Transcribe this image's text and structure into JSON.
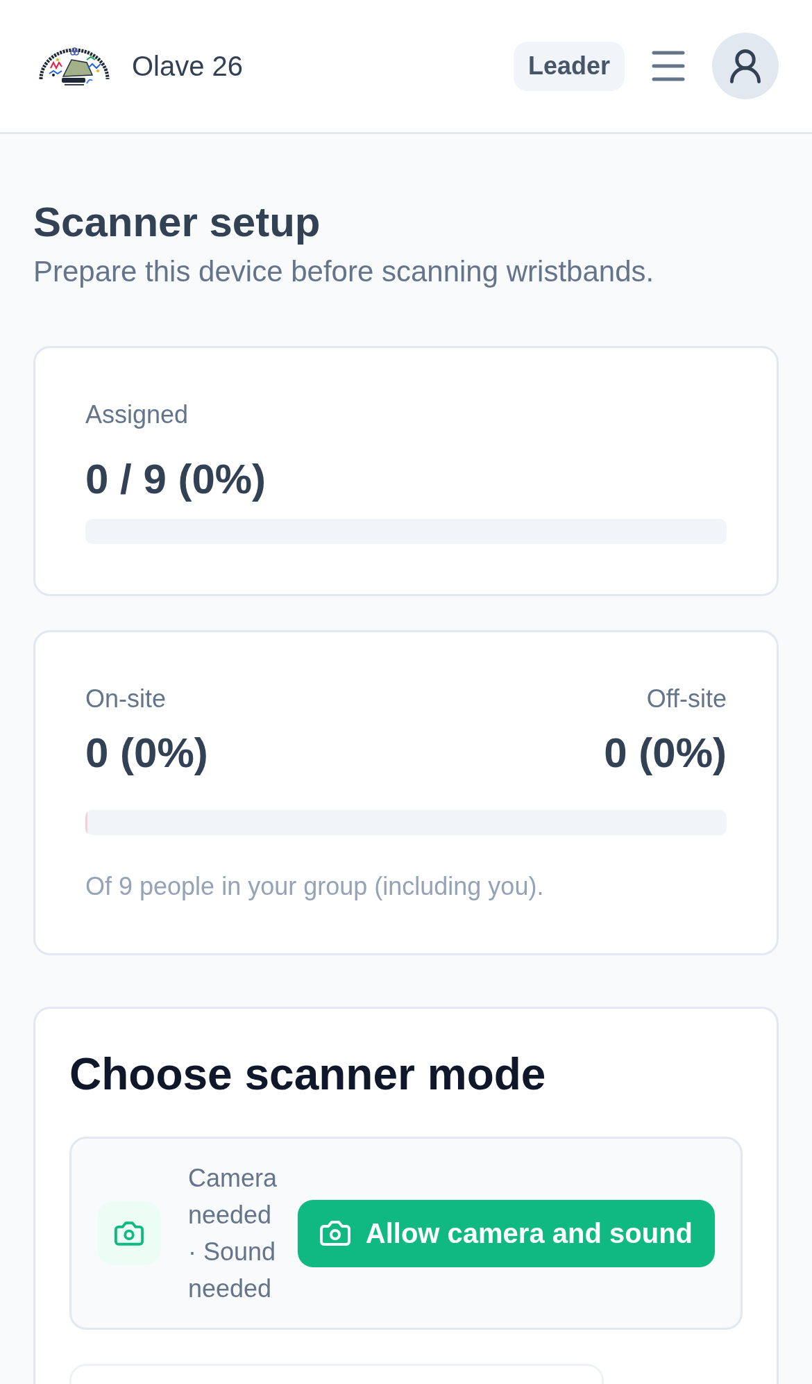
{
  "header": {
    "app_name": "Olave 26",
    "role_badge": "Leader"
  },
  "page": {
    "title": "Scanner setup",
    "subtitle": "Prepare this device before scanning wristbands."
  },
  "assigned": {
    "label": "Assigned",
    "value": "0 / 9 (0%)",
    "level": 0
  },
  "presence": {
    "on_site": {
      "label": "On-site",
      "value": "0 (0%)"
    },
    "off_site": {
      "label": "Off-site",
      "value": "0 (0%)"
    },
    "level": 0,
    "note": "Of 9 people in your group (including you)."
  },
  "scanner_mode": {
    "title": "Choose scanner mode",
    "options": [
      {
        "kind": "camera",
        "status": "Camera needed · Sound needed",
        "action": "Allow camera and sound"
      }
    ]
  }
}
